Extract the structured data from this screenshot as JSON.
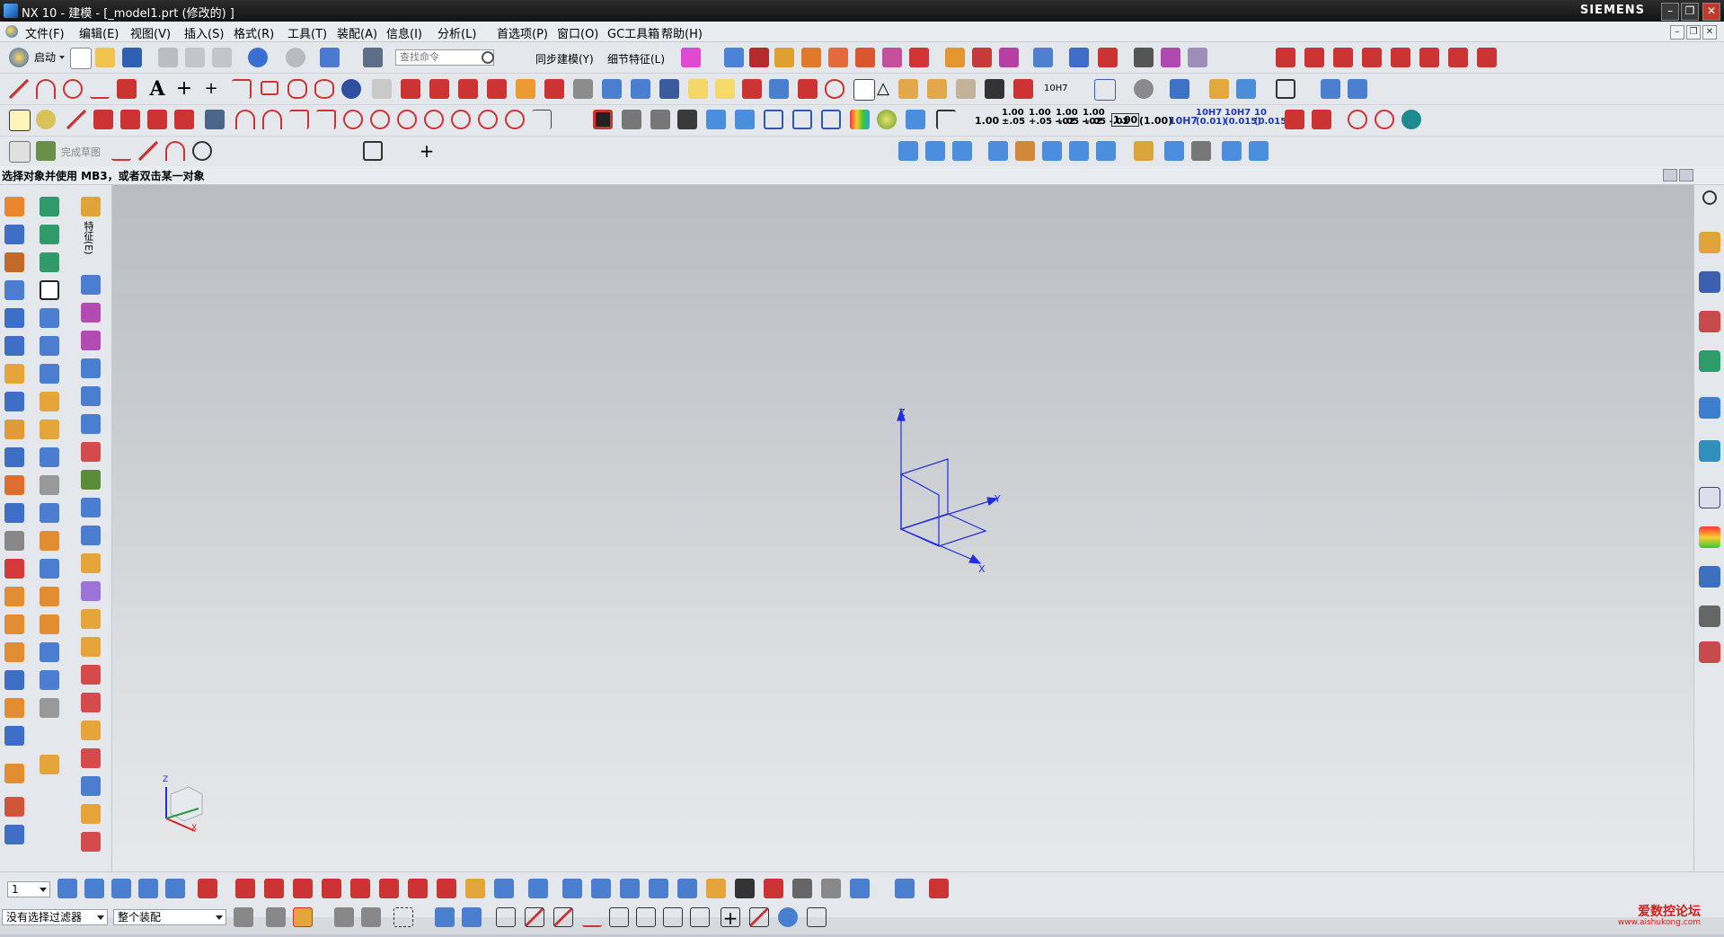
{
  "window": {
    "title": "NX 10 - 建模 - [_model1.prt (修改的) ]",
    "brand": "SIEMENS",
    "controls": [
      "–",
      "❐",
      "✕"
    ]
  },
  "menu": {
    "items": [
      "文件(F)",
      "编辑(E)",
      "视图(V)",
      "插入(S)",
      "格式(R)",
      "工具(T)",
      "装配(A)",
      "信息(I)",
      "分析(L)",
      "首选项(P)",
      "窗口(O)",
      "GC工具箱",
      "帮助(H)"
    ]
  },
  "toolbar": {
    "start_label": "启动",
    "search_placeholder": "查找命令",
    "sync_label": "同步建模(Y)",
    "detail_label": "细节特征(L)",
    "finish_sketch": "完成草图",
    "dims": [
      "1.00",
      "1.00\n±.05",
      "1.00\n+.05 -.02",
      "1.00\n+.05 -.02",
      "1.00\n+.05 -.02",
      "1.00",
      "(1.00)",
      "10H7",
      "10H7\n(0.01)",
      "10H7\n(0.015)",
      "10\n(0.015)"
    ]
  },
  "cue_line": "选择对象并使用 MB3，或者双击某一对象",
  "left_panel": {
    "vertical_label": "特征(E)"
  },
  "viewport": {
    "axes": {
      "x": "X",
      "y": "Y",
      "z": "Z"
    },
    "axis_color": "#1f2ee0"
  },
  "bottom": {
    "layer_value": "1",
    "filter_value": "没有选择过滤器",
    "assembly_value": "整个装配"
  },
  "watermark": {
    "text": "爱数控论坛",
    "url": "www.aishukong.com"
  }
}
